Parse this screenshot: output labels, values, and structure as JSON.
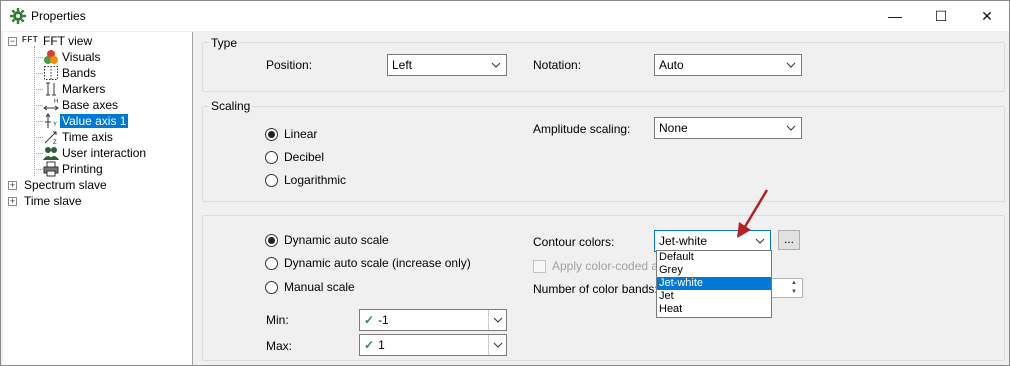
{
  "window": {
    "title": "Properties",
    "minimize": "—",
    "maximize": "☐",
    "close": "✕"
  },
  "tree": {
    "root": {
      "badge": "FFT",
      "label": "FFT view",
      "expander": "−"
    },
    "children": [
      {
        "label": "Visuals",
        "icon": "visuals-icon"
      },
      {
        "label": "Bands",
        "icon": "bands-icon"
      },
      {
        "label": "Markers",
        "icon": "markers-icon"
      },
      {
        "label": "Base axes",
        "icon": "base-axes-icon"
      },
      {
        "label": "Value axis 1",
        "icon": "value-axis-icon",
        "selected": true
      },
      {
        "label": "Time axis",
        "icon": "time-axis-icon"
      },
      {
        "label": "User interaction",
        "icon": "user-interaction-icon"
      },
      {
        "label": "Printing",
        "icon": "printer-icon"
      }
    ],
    "others": [
      {
        "label": "Spectrum slave",
        "expander": "+"
      },
      {
        "label": "Time slave",
        "expander": "+"
      }
    ]
  },
  "type_group": {
    "title": "Type",
    "position_label": "Position:",
    "position_value": "Left",
    "notation_label": "Notation:",
    "notation_value": "Auto"
  },
  "scaling_group": {
    "title": "Scaling",
    "linear": "Linear",
    "decibel": "Decibel",
    "logarithmic": "Logarithmic",
    "amplitude_label": "Amplitude scaling:",
    "amplitude_value": "None"
  },
  "auto_group": {
    "dynamic": "Dynamic auto scale",
    "dynamic_inc": "Dynamic auto scale (increase only)",
    "manual": "Manual scale",
    "min_label": "Min:",
    "min_value": "-1",
    "max_label": "Max:",
    "max_value": "1",
    "contour_label": "Contour colors:",
    "contour_value": "Jet-white",
    "contour_button": "...",
    "apply_label": "Apply color-coded amp",
    "bands_label": "Number of color bands:",
    "contour_options": [
      "Default",
      "Grey",
      "Jet-white",
      "Jet",
      "Heat"
    ],
    "selected_option": "Jet-white"
  },
  "colors": {
    "selection": "#0078d7",
    "annotation_arrow": "#b22222"
  }
}
